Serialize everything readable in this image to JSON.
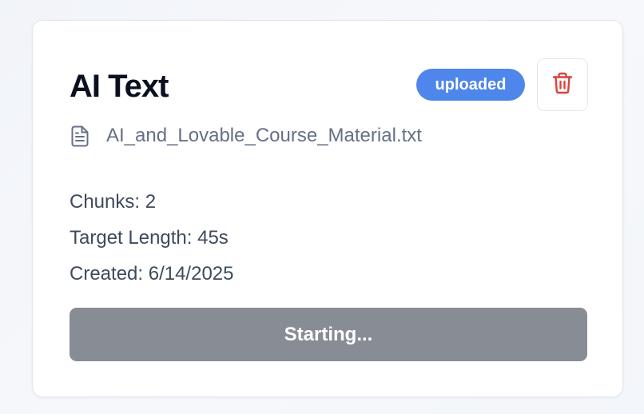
{
  "card": {
    "title": "AI Text",
    "status_badge": "uploaded",
    "file_name": "AI_and_Lovable_Course_Material.txt",
    "chunks_text": "Chunks: 2",
    "target_length_text": "Target Length: 45s",
    "created_text": "Created: 6/14/2025",
    "action_button_label": "Starting..."
  },
  "icons": {
    "delete": "trash-icon",
    "file": "file-text-icon"
  },
  "colors": {
    "badge_bg": "#4f86ec",
    "delete_icon": "#d9443a",
    "action_button_bg": "#888c95",
    "title": "#0b1020",
    "muted_text": "#647086"
  }
}
